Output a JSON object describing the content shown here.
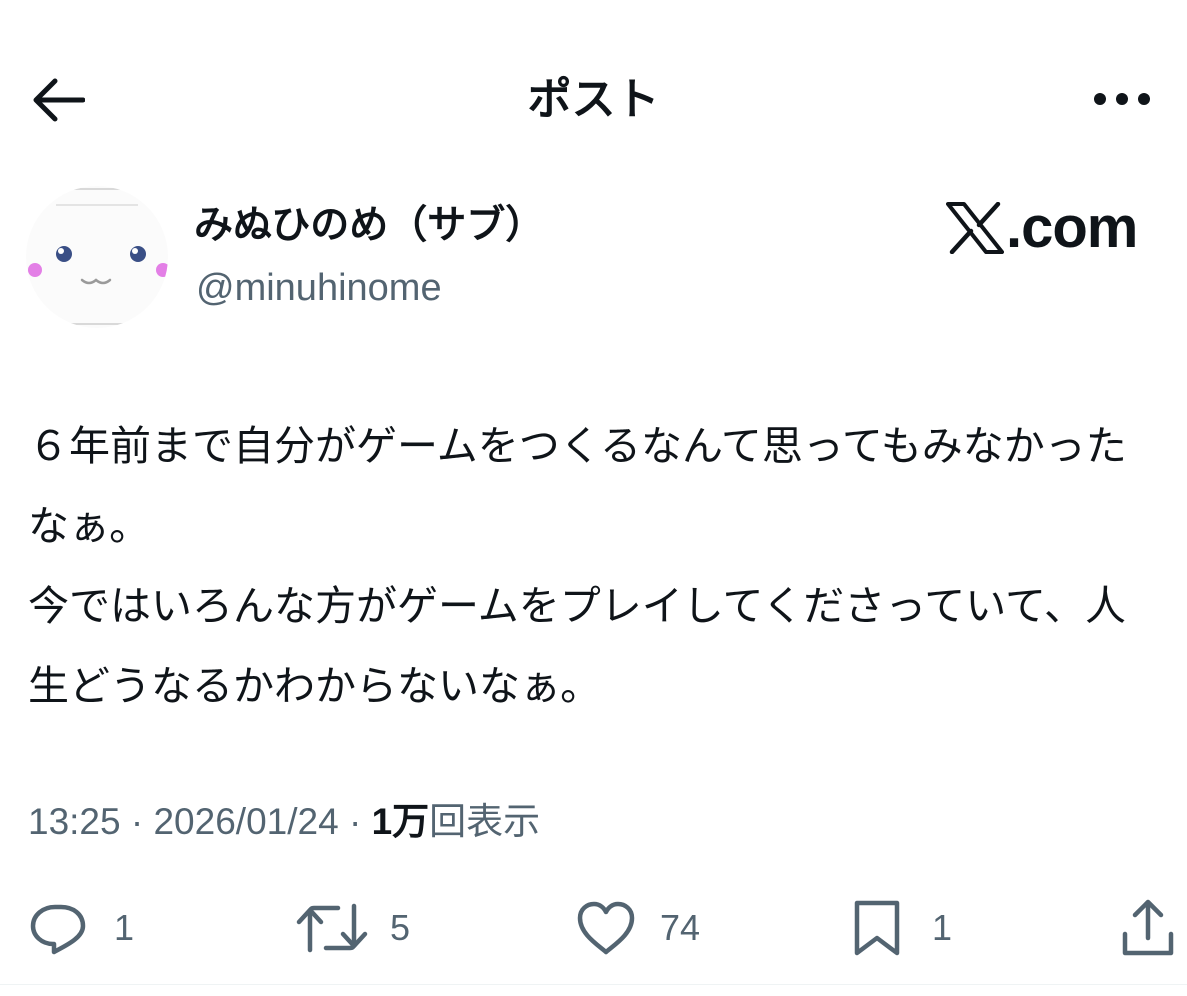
{
  "header": {
    "title": "ポスト",
    "back_icon": "arrow-left-icon",
    "more_icon": "more-dots-icon"
  },
  "author": {
    "display_name": "みぬひのめ（サブ）",
    "handle": "@minuhinome"
  },
  "brand": {
    "text": ".com",
    "logo_icon": "x-logo-icon"
  },
  "post": {
    "text": "６年前まで自分がゲームをつくるなんて思ってもみなかったなぁ。\n今ではいろんな方がゲームをプレイしてくださっていて、人生どうなるかわからないなぁ。"
  },
  "meta": {
    "time": "13:25",
    "separator": " · ",
    "date": "2026/01/24",
    "views_count": "1万",
    "views_label": "回表示"
  },
  "actions": {
    "reply_count": "1",
    "repost_count": "5",
    "like_count": "74",
    "bookmark_count": "1"
  },
  "colors": {
    "text": "#0f1419",
    "secondary": "#536471",
    "avatar_cheek": "#e37fe6",
    "avatar_eye": "#3a4f86"
  }
}
